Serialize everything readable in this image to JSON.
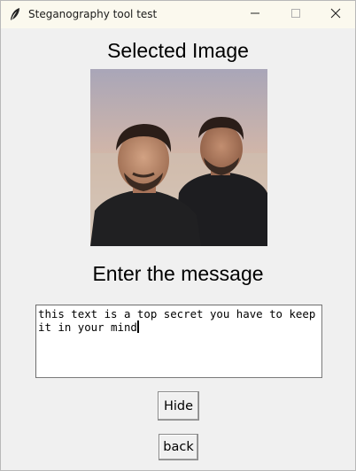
{
  "window": {
    "title": "Steganography tool test",
    "controls": [
      "minimize-icon",
      "maximize-icon",
      "close-icon"
    ]
  },
  "image_section": {
    "heading": "Selected Image"
  },
  "message_section": {
    "heading": "Enter the message",
    "textbox_value": "this text is a top secret you have to keep it in your mind"
  },
  "buttons": {
    "hide_label": "Hide",
    "back_label": "back"
  },
  "colors": {
    "titlebar": "#fbf9ee",
    "background": "#f0f0f0",
    "textbox": "#ffffff"
  }
}
